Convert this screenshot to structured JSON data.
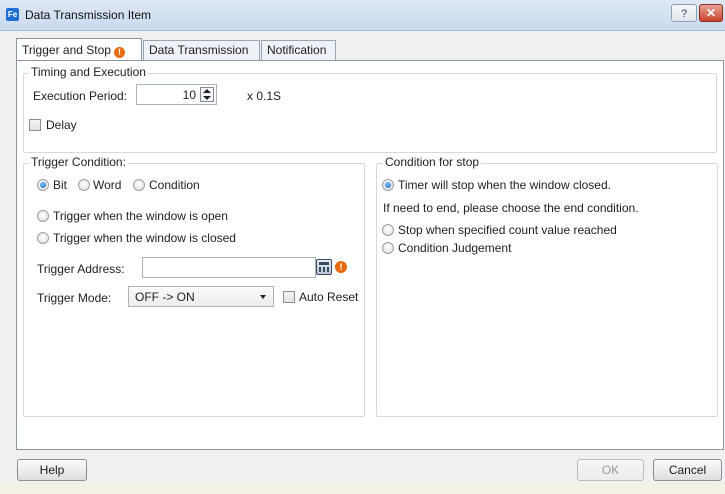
{
  "window": {
    "title": "Data Transmission Item",
    "app_icon_text": "Fe",
    "help_glyph": "?",
    "close_glyph": "✕"
  },
  "tabs": [
    {
      "label": "Trigger and Stop",
      "active": true,
      "warning": "!"
    },
    {
      "label": "Data Transmission",
      "active": false
    },
    {
      "label": "Notification",
      "active": false
    }
  ],
  "timing": {
    "group_title": "Timing and Execution",
    "period_label": "Execution Period:",
    "period_value": "10",
    "period_unit": "x 0.1S",
    "delay_label": "Delay",
    "delay_checked": false
  },
  "trigger": {
    "group_title": "Trigger Condition:",
    "type_options": [
      "Bit",
      "Word",
      "Condition"
    ],
    "type_selected": "Bit",
    "window_open_label": "Trigger when the window is open",
    "window_closed_label": "Trigger when the window is closed",
    "address_label": "Trigger Address:",
    "address_value": "",
    "address_warning": "!",
    "mode_label": "Trigger Mode:",
    "mode_value": "OFF -> ON",
    "auto_reset_label": "Auto Reset",
    "auto_reset_checked": false
  },
  "stop": {
    "group_title": "Condition for stop",
    "timer_label": "Timer will stop when the window closed.",
    "info_text": "If need to end, please choose the end condition.",
    "count_label": "Stop when specified count value reached",
    "judgement_label": "Condition Judgement"
  },
  "buttons": {
    "help": "Help",
    "ok": "OK",
    "cancel": "Cancel"
  }
}
